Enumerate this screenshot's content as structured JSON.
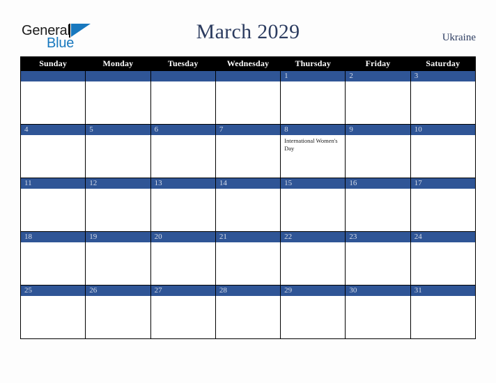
{
  "brand": {
    "word_one": "General",
    "word_two": "Blue",
    "accent_color": "#1878be",
    "triangle_icon": "brand-triangle-icon"
  },
  "header": {
    "title": "March 2029",
    "country": "Ukraine",
    "title_color": "#2c3c60"
  },
  "calendar": {
    "weekday_headers": [
      "Sunday",
      "Monday",
      "Tuesday",
      "Wednesday",
      "Thursday",
      "Friday",
      "Saturday"
    ],
    "header_bg": "#000000",
    "daynum_bg": "#2f5596",
    "daynum_color": "#d6dce9",
    "weeks": [
      [
        {
          "day": "",
          "events": []
        },
        {
          "day": "",
          "events": []
        },
        {
          "day": "",
          "events": []
        },
        {
          "day": "",
          "events": []
        },
        {
          "day": "1",
          "events": []
        },
        {
          "day": "2",
          "events": []
        },
        {
          "day": "3",
          "events": []
        }
      ],
      [
        {
          "day": "4",
          "events": []
        },
        {
          "day": "5",
          "events": []
        },
        {
          "day": "6",
          "events": []
        },
        {
          "day": "7",
          "events": []
        },
        {
          "day": "8",
          "events": [
            "International Women's Day"
          ]
        },
        {
          "day": "9",
          "events": []
        },
        {
          "day": "10",
          "events": []
        }
      ],
      [
        {
          "day": "11",
          "events": []
        },
        {
          "day": "12",
          "events": []
        },
        {
          "day": "13",
          "events": []
        },
        {
          "day": "14",
          "events": []
        },
        {
          "day": "15",
          "events": []
        },
        {
          "day": "16",
          "events": []
        },
        {
          "day": "17",
          "events": []
        }
      ],
      [
        {
          "day": "18",
          "events": []
        },
        {
          "day": "19",
          "events": []
        },
        {
          "day": "20",
          "events": []
        },
        {
          "day": "21",
          "events": []
        },
        {
          "day": "22",
          "events": []
        },
        {
          "day": "23",
          "events": []
        },
        {
          "day": "24",
          "events": []
        }
      ],
      [
        {
          "day": "25",
          "events": []
        },
        {
          "day": "26",
          "events": []
        },
        {
          "day": "27",
          "events": []
        },
        {
          "day": "28",
          "events": []
        },
        {
          "day": "29",
          "events": []
        },
        {
          "day": "30",
          "events": []
        },
        {
          "day": "31",
          "events": []
        }
      ]
    ]
  }
}
